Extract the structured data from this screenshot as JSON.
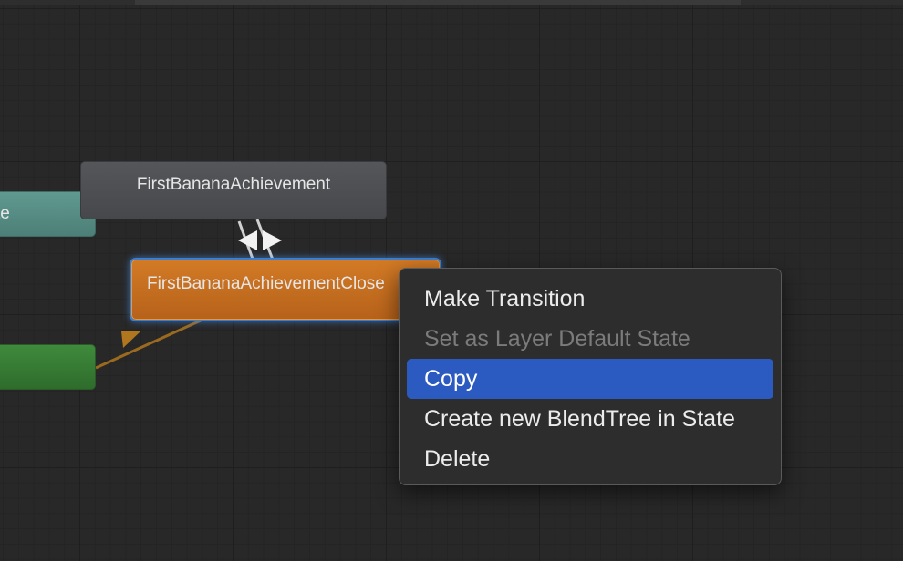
{
  "canvas": {
    "background": "#282828",
    "accent_selection": "#2b5bc0",
    "state_colors": {
      "teal": "#5a938a",
      "gray": "#4d4f53",
      "green": "#357a33",
      "orange": "#c56e20",
      "transition_arrow": "#9a6a1e"
    }
  },
  "nodes": {
    "teal_partial_label": "te",
    "gray_label": "FirstBananaAchievement",
    "orange_label": "FirstBananaAchievementClose",
    "green_label": ""
  },
  "context_menu": {
    "items": [
      {
        "label": "Make Transition",
        "enabled": true,
        "selected": false
      },
      {
        "label": "Set as Layer Default State",
        "enabled": false,
        "selected": false
      },
      {
        "label": "Copy",
        "enabled": true,
        "selected": true
      },
      {
        "label": "Create new BlendTree in State",
        "enabled": true,
        "selected": false
      },
      {
        "label": "Delete",
        "enabled": true,
        "selected": false
      }
    ]
  }
}
